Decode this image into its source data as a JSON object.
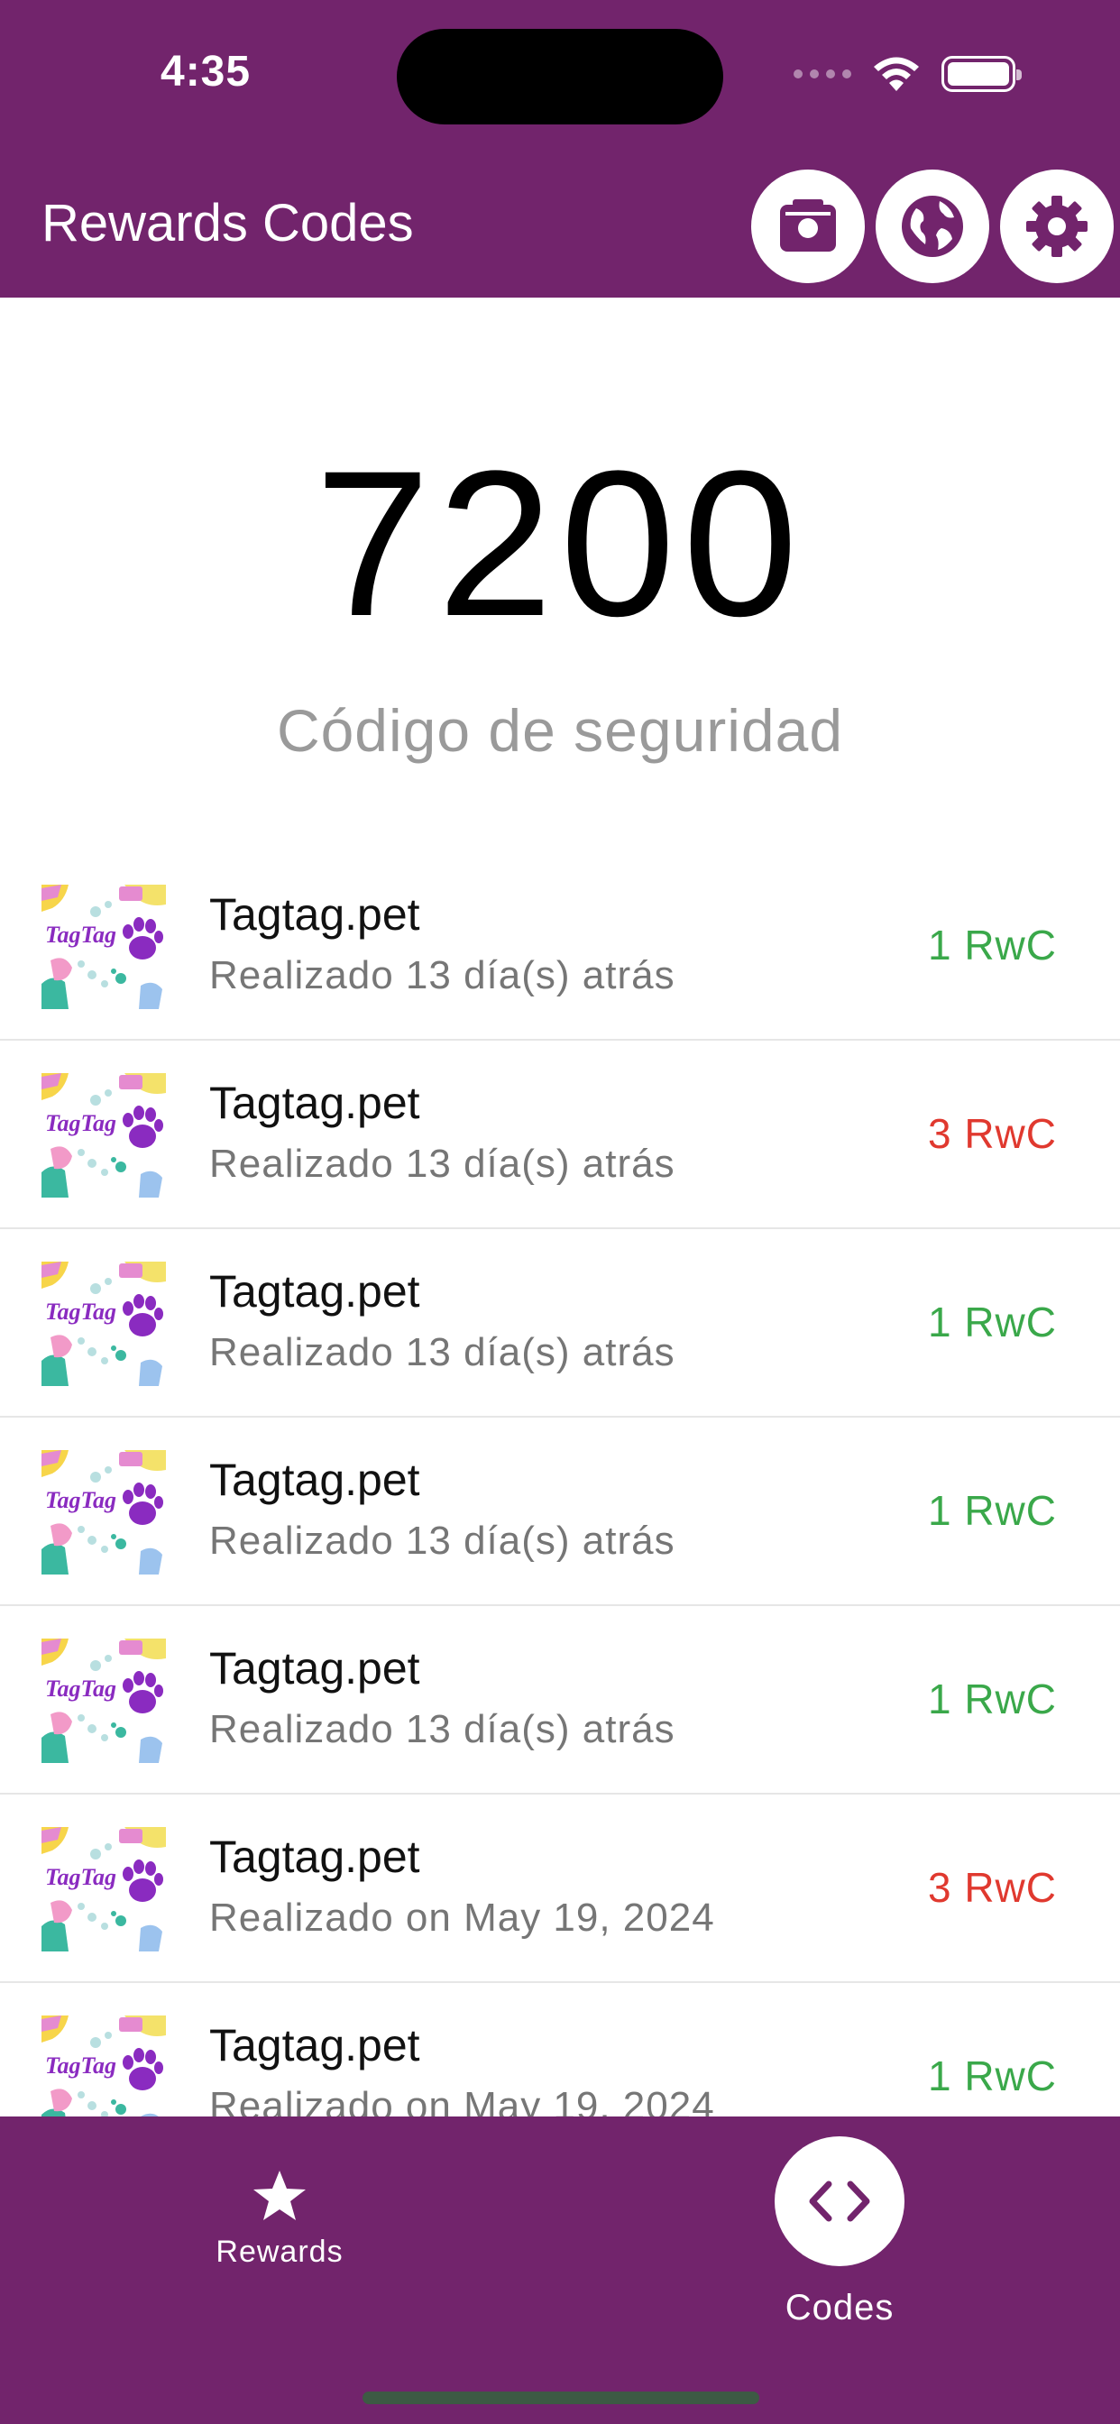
{
  "status_bar": {
    "time": "4:35"
  },
  "header": {
    "title": "Rewards Codes",
    "buttons": [
      "camera-icon",
      "globe-icon",
      "gear-icon"
    ]
  },
  "security": {
    "code": "7200",
    "label": "Código de seguridad"
  },
  "list": {
    "items": [
      {
        "title": "Tagtag.pet",
        "subtitle": "Realizado 13 día(s) atrás",
        "amount": "1 RwC",
        "color": "#3aa84a"
      },
      {
        "title": "Tagtag.pet",
        "subtitle": "Realizado 13 día(s) atrás",
        "amount": "3 RwC",
        "color": "#e0392f"
      },
      {
        "title": "Tagtag.pet",
        "subtitle": "Realizado 13 día(s) atrás",
        "amount": "1 RwC",
        "color": "#3aa84a"
      },
      {
        "title": "Tagtag.pet",
        "subtitle": "Realizado 13 día(s) atrás",
        "amount": "1 RwC",
        "color": "#3aa84a"
      },
      {
        "title": "Tagtag.pet",
        "subtitle": "Realizado 13 día(s) atrás",
        "amount": "1 RwC",
        "color": "#3aa84a"
      },
      {
        "title": "Tagtag.pet",
        "subtitle": "Realizado on May 19, 2024",
        "amount": "3 RwC",
        "color": "#e0392f"
      },
      {
        "title": "Tagtag.pet",
        "subtitle": "Realizado on May 19, 2024",
        "amount": "1 RwC",
        "color": "#3aa84a"
      }
    ]
  },
  "bottom_nav": {
    "rewards_label": "Rewards",
    "codes_label": "Codes"
  },
  "colors": {
    "brand": "#72246c",
    "positive": "#3aa84a",
    "negative": "#e0392f"
  }
}
